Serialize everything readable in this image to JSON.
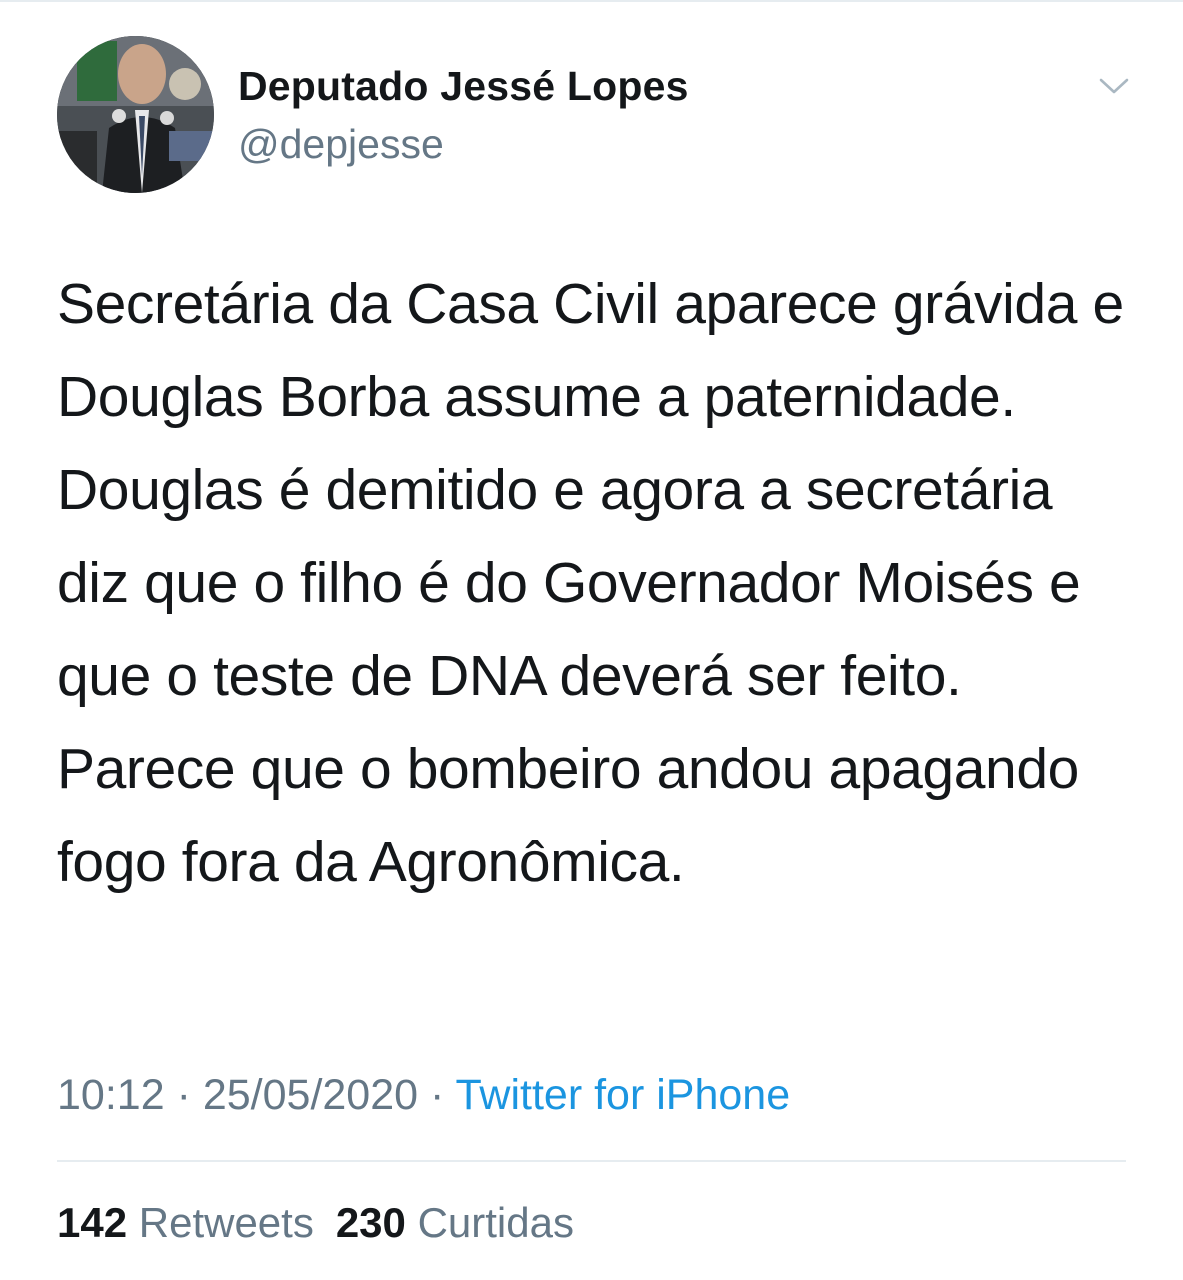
{
  "author": {
    "display_name": "Deputado Jessé Lopes",
    "handle": "@depjesse",
    "avatar_icon": "profile-photo"
  },
  "menu": {
    "icon": "chevron-down-icon"
  },
  "tweet": {
    "text": "Secretária da Casa Civil aparece grávida e Douglas Borba assume a paternidade. Douglas é demitido e agora a secretária diz que o filho é do Governador Moisés e que o teste de DNA deverá ser feito. Parece que o bombeiro andou apagando fogo fora da Agronômica."
  },
  "meta": {
    "time": "10:12",
    "separator": "·",
    "date": "25/05/2020",
    "source": "Twitter for iPhone"
  },
  "stats": {
    "retweets_count": "142",
    "retweets_label": "Retweets",
    "likes_count": "230",
    "likes_label": "Curtidas"
  },
  "colors": {
    "text": "#14171a",
    "secondary": "#657786",
    "link": "#1b95e0",
    "divider": "#e6ecf0",
    "chevron": "#aab8c2"
  }
}
